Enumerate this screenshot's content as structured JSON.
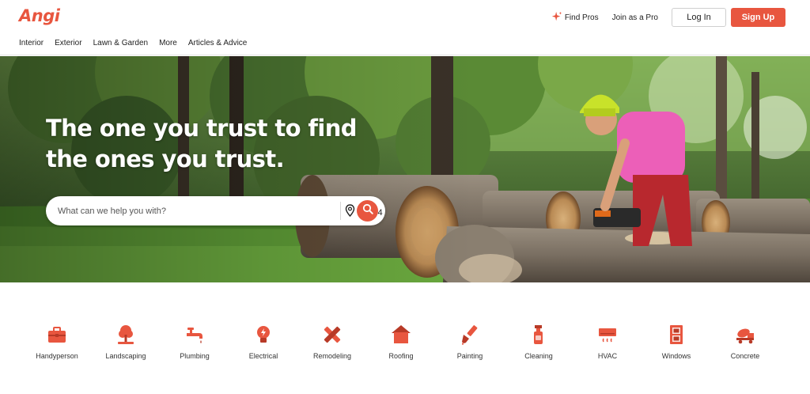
{
  "header": {
    "logo": "Angi",
    "nav": [
      "Interior",
      "Exterior",
      "Lawn & Garden",
      "More",
      "Articles & Advice"
    ],
    "find_pros": "Find Pros",
    "join_pro": "Join as a Pro",
    "login": "Log In",
    "signup": "Sign Up"
  },
  "hero": {
    "title": "The one you trust to find the ones you trust.",
    "search_placeholder": "What can we help you with?",
    "zip_value": "10004"
  },
  "categories": [
    {
      "label": "Handyperson",
      "icon": "toolbox-icon"
    },
    {
      "label": "Landscaping",
      "icon": "tree-icon"
    },
    {
      "label": "Plumbing",
      "icon": "faucet-icon"
    },
    {
      "label": "Electrical",
      "icon": "lightbulb-icon"
    },
    {
      "label": "Remodeling",
      "icon": "ruler-pencil-icon"
    },
    {
      "label": "Roofing",
      "icon": "house-roof-icon"
    },
    {
      "label": "Painting",
      "icon": "paintbrush-icon"
    },
    {
      "label": "Cleaning",
      "icon": "spray-bottle-icon"
    },
    {
      "label": "HVAC",
      "icon": "air-conditioner-icon"
    },
    {
      "label": "Windows",
      "icon": "window-icon"
    },
    {
      "label": "Concrete",
      "icon": "cement-mixer-icon"
    }
  ],
  "colors": {
    "brand": "#e8563f",
    "text": "#1f1f1f"
  }
}
